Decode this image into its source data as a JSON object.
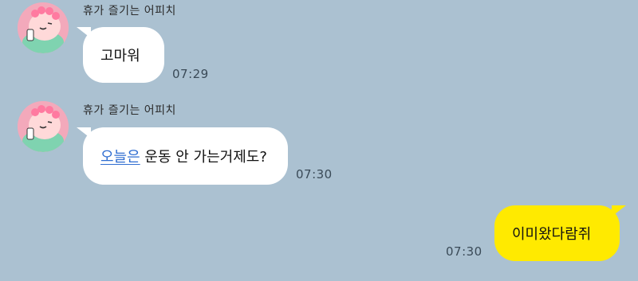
{
  "messages": [
    {
      "sender": "휴가 즐기는 어피치",
      "text": "고마워",
      "time": "07:29"
    },
    {
      "sender": "휴가 즐기는 어피치",
      "link_text": "오늘은",
      "text_rest": " 운동 안 가는거제도?",
      "time": "07:30"
    },
    {
      "text": "이미왔다람쥐",
      "time": "07:30"
    }
  ],
  "colors": {
    "background": "#abc1d1",
    "incoming_bubble": "#ffffff",
    "outgoing_bubble": "#ffea00",
    "link": "#2f6dd1"
  },
  "icons": {
    "avatar": "apeach-character-avatar-icon"
  }
}
